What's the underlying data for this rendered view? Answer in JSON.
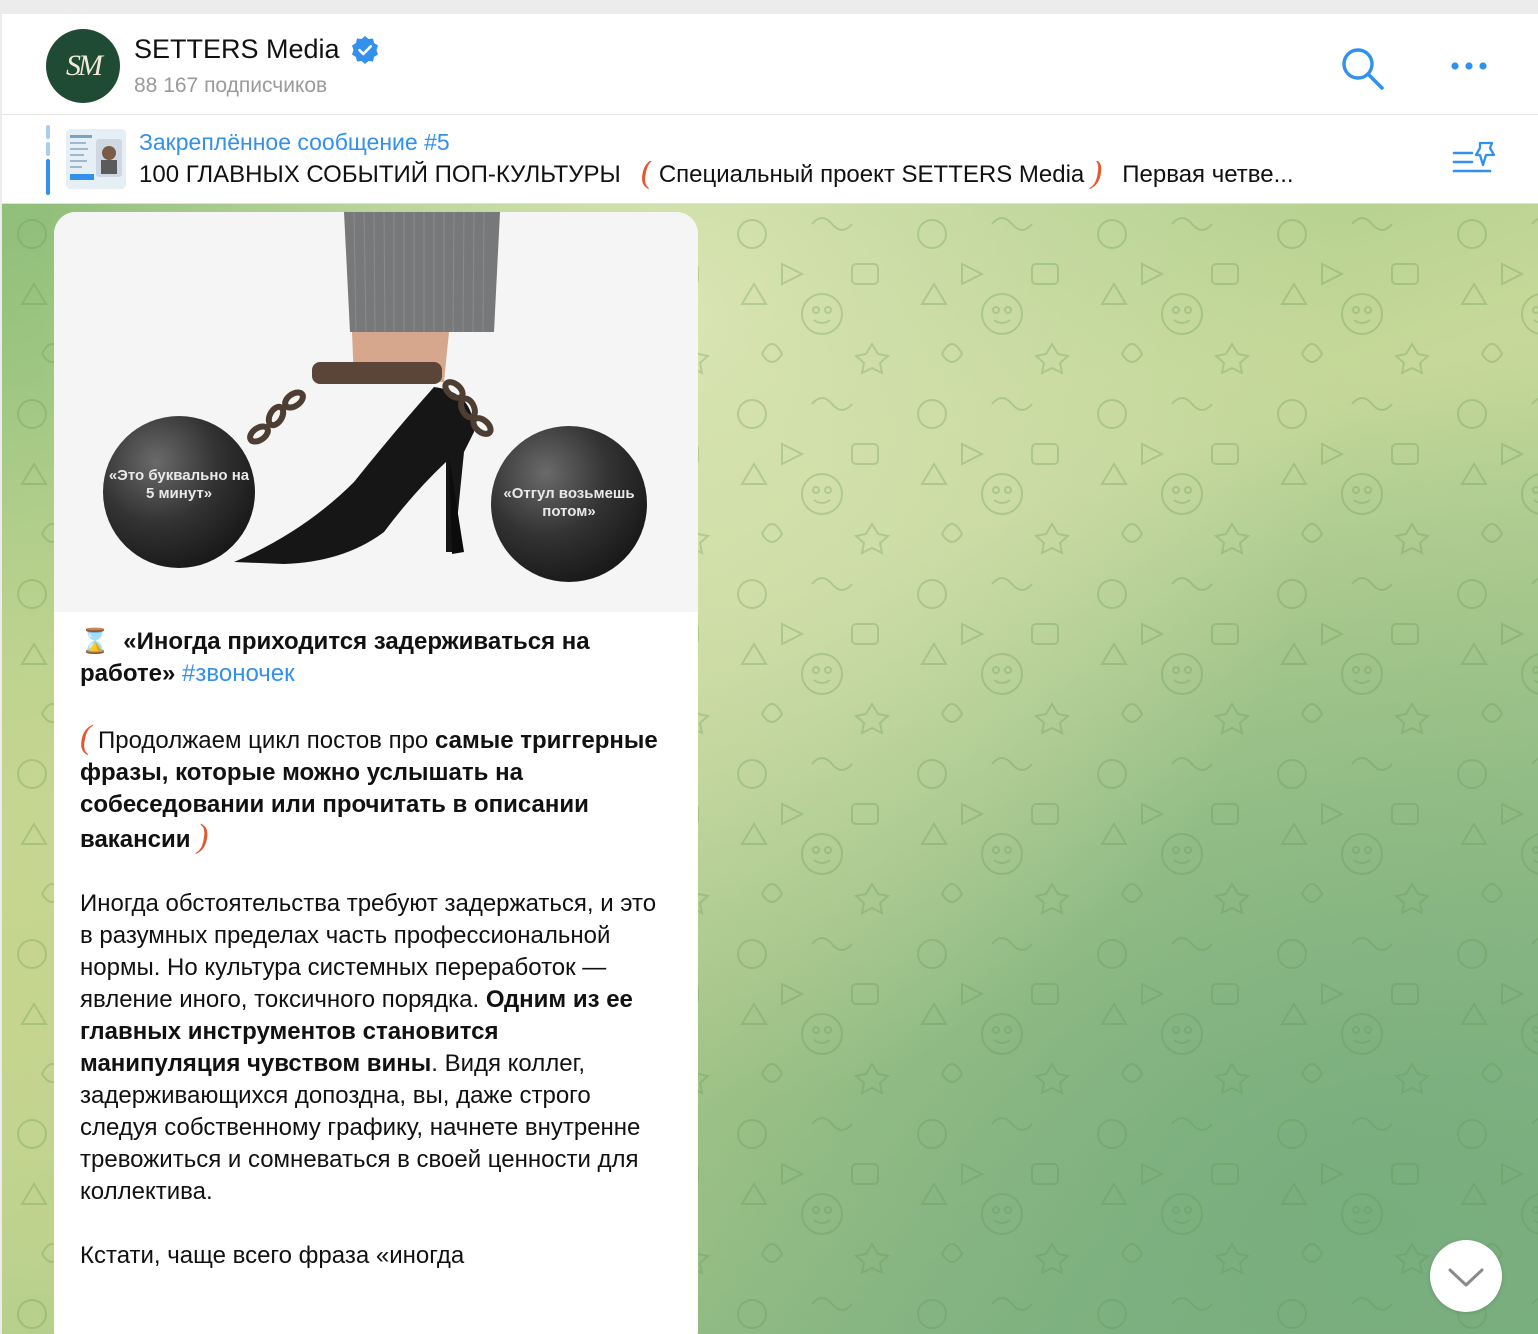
{
  "header": {
    "avatar_text": "SM",
    "channel_name": "SETTERS Media",
    "subscribers": "88 167 подписчиков"
  },
  "pinned": {
    "title": "Закреплённое сообщение #5",
    "text_part1": "100 ГЛАВНЫХ СОБЫТИЙ ПОП-КУЛЬТУРЫ",
    "text_part2": "Специальный проект SETTERS Media",
    "text_part3": "Первая четве...",
    "bracket_open": "(",
    "bracket_close": ")"
  },
  "post": {
    "image": {
      "ball_left_text": "«Это буквально на 5 минут»",
      "ball_right_text": "«Отгул возьмешь потом»"
    },
    "emoji": "⌛",
    "headline": "«Иногда приходится задерживаться на работе»",
    "hashtag": "#звоночек",
    "p1_prefix": "Продолжаем цикл постов про ",
    "p1_bold": "самые триггерные фразы, которые можно услышать на собеседовании или прочитать в описании вакансии",
    "deco_open": "(",
    "deco_close": ")",
    "p2_text1": "Иногда обстоятельства требуют задержаться, и это в разумных пределах часть профессиональной нормы. Но культура системных переработок — явление иного, токсичного порядка. ",
    "p2_bold": "Одним из ее главных инструментов становится манипуляция чувством вины",
    "p2_text2": ". Видя коллег, задерживающихся допоздна, вы, даже строго следуя собственному графику, начнете внутренне тревожиться и сомневаться в своей ценности для коллектива.",
    "p3_text": "Кстати, чаще всего фраза «иногда"
  },
  "icons": {
    "verified": "verified-badge-icon",
    "search": "search-icon",
    "more": "more-dots-icon",
    "pinned_list": "pinned-list-icon",
    "scroll_down": "chevron-down-icon"
  },
  "colors": {
    "accent": "#3390ec",
    "decor": "#e2582f",
    "avatar_bg": "#1f4a33"
  }
}
